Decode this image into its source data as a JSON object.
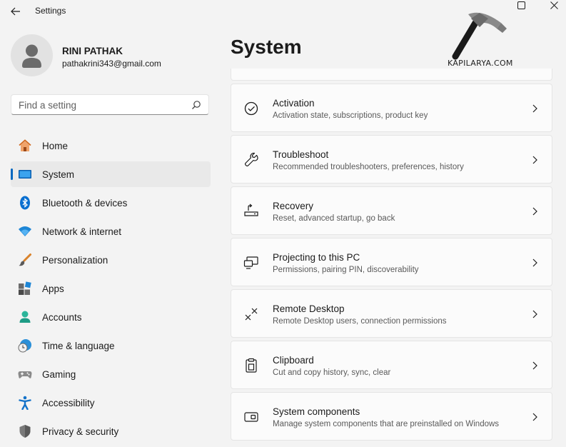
{
  "window": {
    "title": "Settings",
    "watermark": "KAPILARYA.COM"
  },
  "profile": {
    "name": "RINI PATHAK",
    "email": "pathakrini343@gmail.com"
  },
  "search": {
    "placeholder": "Find a setting"
  },
  "nav": {
    "items": [
      {
        "label": "Home",
        "icon": "home-icon"
      },
      {
        "label": "System",
        "icon": "system-icon",
        "active": true
      },
      {
        "label": "Bluetooth & devices",
        "icon": "bluetooth-icon"
      },
      {
        "label": "Network & internet",
        "icon": "wifi-icon"
      },
      {
        "label": "Personalization",
        "icon": "brush-icon"
      },
      {
        "label": "Apps",
        "icon": "apps-icon"
      },
      {
        "label": "Accounts",
        "icon": "accounts-icon"
      },
      {
        "label": "Time & language",
        "icon": "time-language-icon"
      },
      {
        "label": "Gaming",
        "icon": "gamepad-icon"
      },
      {
        "label": "Accessibility",
        "icon": "accessibility-icon"
      },
      {
        "label": "Privacy & security",
        "icon": "shield-icon"
      }
    ]
  },
  "main": {
    "title": "System",
    "cards": [
      {
        "title": "Activation",
        "subtitle": "Activation state, subscriptions, product key",
        "icon": "activation-check-icon"
      },
      {
        "title": "Troubleshoot",
        "subtitle": "Recommended troubleshooters, preferences, history",
        "icon": "wrench-icon"
      },
      {
        "title": "Recovery",
        "subtitle": "Reset, advanced startup, go back",
        "icon": "recovery-icon"
      },
      {
        "title": "Projecting to this PC",
        "subtitle": "Permissions, pairing PIN, discoverability",
        "icon": "projecting-icon"
      },
      {
        "title": "Remote Desktop",
        "subtitle": "Remote Desktop users, connection permissions",
        "icon": "remote-desktop-icon"
      },
      {
        "title": "Clipboard",
        "subtitle": "Cut and copy history, sync, clear",
        "icon": "clipboard-icon"
      },
      {
        "title": "System components",
        "subtitle": "Manage system components that are preinstalled on Windows",
        "icon": "system-components-icon"
      }
    ]
  },
  "colors": {
    "accent": "#0067c0",
    "background": "#f3f3f3",
    "card": "#fbfbfb"
  }
}
